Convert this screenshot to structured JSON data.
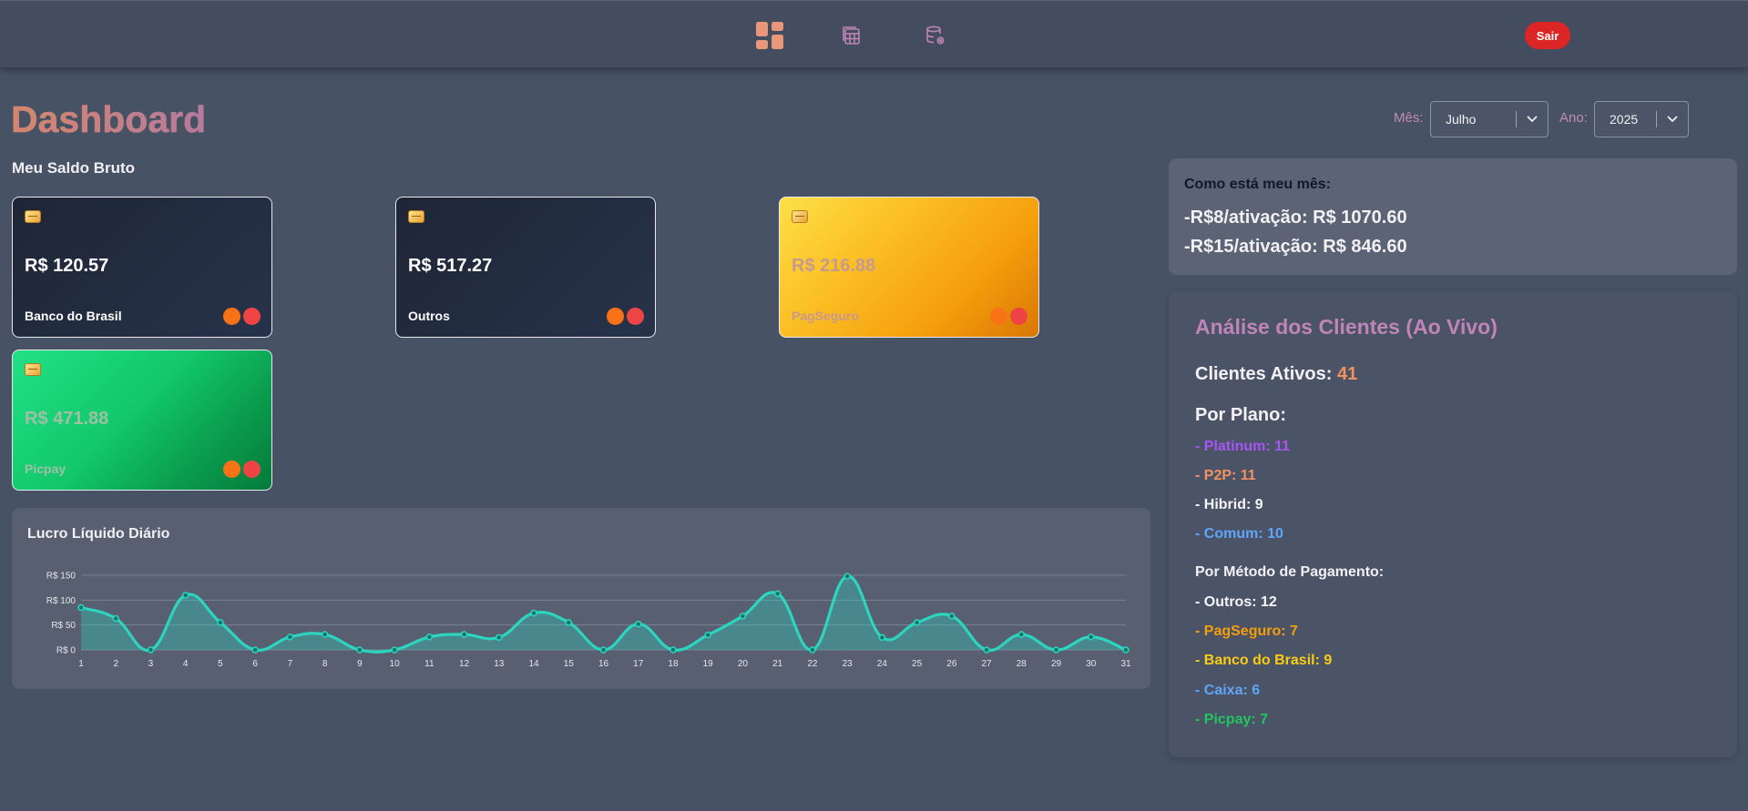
{
  "nav": {
    "icons": [
      "dashboard-icon",
      "calculator-icon",
      "database-settings-icon"
    ],
    "logout_label": "Sair",
    "colors": {
      "dashboard": "#e9967a",
      "other": "#c084b8",
      "logout": "#dc2626"
    }
  },
  "page": {
    "title": "Dashboard",
    "balance_label": "Meu Saldo Bruto"
  },
  "filters": {
    "month_label": "Mês:",
    "month_value": "Julho",
    "year_label": "Ano:",
    "year_value": "2025"
  },
  "cards": [
    {
      "amount": "R$ 120.57",
      "bank": "Banco do Brasil",
      "style": "dark"
    },
    {
      "amount": "R$ 517.27",
      "bank": "Outros",
      "style": "dark"
    },
    {
      "amount": "R$ 216.88",
      "bank": "PagSeguro",
      "style": "gold"
    },
    {
      "amount": "R$ 471.88",
      "bank": "Picpay",
      "style": "green"
    }
  ],
  "month_summary": {
    "title": "Como está meu mês:",
    "line1": "-R$8/ativação: R$ 1070.60",
    "line2": "-R$15/ativação: R$ 846.60"
  },
  "clients": {
    "title": "Análise dos Clientes (Ao Vivo)",
    "active_label": "Clientes Ativos:",
    "active_count": "41",
    "plan_heading": "Por Plano:",
    "plans": [
      {
        "text": "- Platinum: 11",
        "color": "#a855f7"
      },
      {
        "text": "- P2P: 11",
        "color": "#f0935e"
      },
      {
        "text": "- Hibrid: 9",
        "color": "#f3f4f6"
      },
      {
        "text": "- Comum: 10",
        "color": "#60a5fa"
      }
    ],
    "payment_heading": "Por Método de Pagamento:",
    "payments": [
      {
        "text": "- Outros: 12",
        "color": "#f3f4f6"
      },
      {
        "text": "- PagSeguro: 7",
        "color": "#f59e0b"
      },
      {
        "text": "- Banco do Brasil: 9",
        "color": "#facc15"
      },
      {
        "text": "- Caixa: 6",
        "color": "#60a5fa"
      },
      {
        "text": "- Picpay: 7",
        "color": "#22c55e"
      }
    ]
  },
  "chart_data": {
    "type": "area",
    "title": "Lucro Líquido Diário",
    "x": [
      1,
      2,
      3,
      4,
      5,
      6,
      7,
      8,
      9,
      10,
      11,
      12,
      13,
      14,
      15,
      16,
      17,
      18,
      19,
      20,
      21,
      22,
      23,
      24,
      25,
      26,
      27,
      28,
      29,
      30,
      31
    ],
    "values": [
      85,
      63,
      0,
      110,
      55,
      0,
      26,
      31,
      0,
      0,
      26,
      31,
      25,
      74,
      55,
      0,
      52,
      0,
      30,
      68,
      113,
      0,
      148,
      25,
      55,
      68,
      0,
      31,
      0,
      26,
      0
    ],
    "y_ticks": [
      "R$ 0",
      "R$ 50",
      "R$ 100",
      "R$ 150"
    ],
    "y_tick_values": [
      0,
      50,
      100,
      150
    ],
    "ylim": [
      0,
      150
    ],
    "grid": true,
    "line_color": "#2dd4bf",
    "fill_color": "#2dd4bf"
  }
}
